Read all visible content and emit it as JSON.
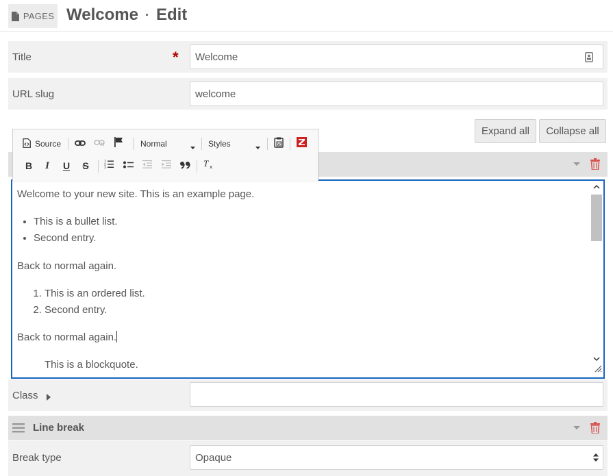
{
  "header": {
    "section_button": "PAGES",
    "title": "Welcome",
    "separator": "·",
    "mode": "Edit"
  },
  "fields": {
    "title": {
      "label": "Title",
      "required_mark": "*",
      "value": "Welcome"
    },
    "slug": {
      "label": "URL slug",
      "value": "welcome"
    },
    "class": {
      "label": "Class",
      "value": ""
    },
    "break_type": {
      "label": "Break type",
      "value": "Opaque"
    }
  },
  "buttons": {
    "expand_all": "Expand all",
    "collapse_all": "Collapse all"
  },
  "toolbar": {
    "source_label": "Source",
    "format_select": "Normal",
    "styles_select": "Styles",
    "bold": "B",
    "italic": "I",
    "underline": "U",
    "strike": "S"
  },
  "editor": {
    "paragraph1": "Welcome to your new site. This is an example page.",
    "bullets": [
      "This is a bullet list.",
      "Second entry."
    ],
    "paragraph2": "Back to normal again.",
    "ordered": [
      "This is an ordered list.",
      "Second entry."
    ],
    "paragraph3": "Back to normal again.",
    "blockquote": "This is a blockquote."
  },
  "blocks": {
    "line_break_title": "Line break"
  },
  "colors": {
    "accent": "#1565c0",
    "required": "#b30000",
    "delete": "#d9534f",
    "z_logo": "#cc2222"
  }
}
